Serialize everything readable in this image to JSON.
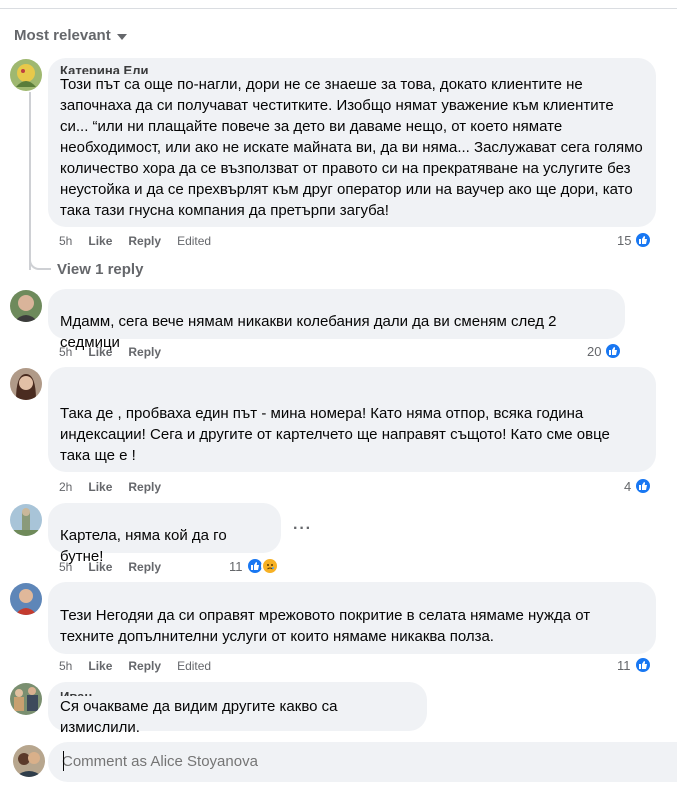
{
  "sort": {
    "label": "Most relevant"
  },
  "colors": {
    "like_blue": "#1877f2",
    "bubble_bg": "#f0f2f5",
    "meta_gray": "#65676b"
  },
  "comments": [
    {
      "author": "Катерина Ели",
      "text": "Този път са още по-нагли, дори не се знаеше за това, докато клиентите не започнаха да си получават честитките. Изобщо нямат уважение към клиентите си... “или ни плащайте повече за дето ви даваме нещо, от което нямате необходимост, или ако не искате майната ви, да ви няма... Заслужават сега голямо количество хора да се възползват от правото си на прекратяване на услугите без неустойка и да се прехвърлят към друг оператор или на ваучер ако ще дори, като така тази гнусна компания да претърпи загуба!",
      "time": "5h",
      "like": "Like",
      "reply": "Reply",
      "edited": "Edited",
      "reactions": "15"
    },
    {
      "author": "",
      "text": "Мдамм, сега вече нямам никакви колебания дали да ви сменям след 2 седмици",
      "time": "5h",
      "like": "Like",
      "reply": "Reply",
      "reactions": "20"
    },
    {
      "author": "",
      "text": "Така де , пробваха един път - мина номера! Като няма отпор, всяка година индексации! Сега и другите от картелчето ще направят същото! Като сме овце така ще е !",
      "time": "2h",
      "like": "Like",
      "reply": "Reply",
      "reactions": "4"
    },
    {
      "author": "",
      "text": "Картела, няма кой да го бутне!",
      "time": "5h",
      "like": "Like",
      "reply": "Reply",
      "reactions": "11"
    },
    {
      "author": "",
      "text": "Тези Негодяи да си оправят мрежовото покритие в селата нямаме нужда от техните допълнителни услуги от които нямаме никаква полза.",
      "time": "5h",
      "like": "Like",
      "reply": "Reply",
      "edited": "Edited",
      "reactions": "11"
    },
    {
      "author": "Иван",
      "text": "Ся очакваме да видим другите какво са измислили."
    }
  ],
  "view_replies": "View 1 reply",
  "more_options": "···",
  "composer": {
    "placeholder": "Comment as Alice Stoyanova"
  }
}
